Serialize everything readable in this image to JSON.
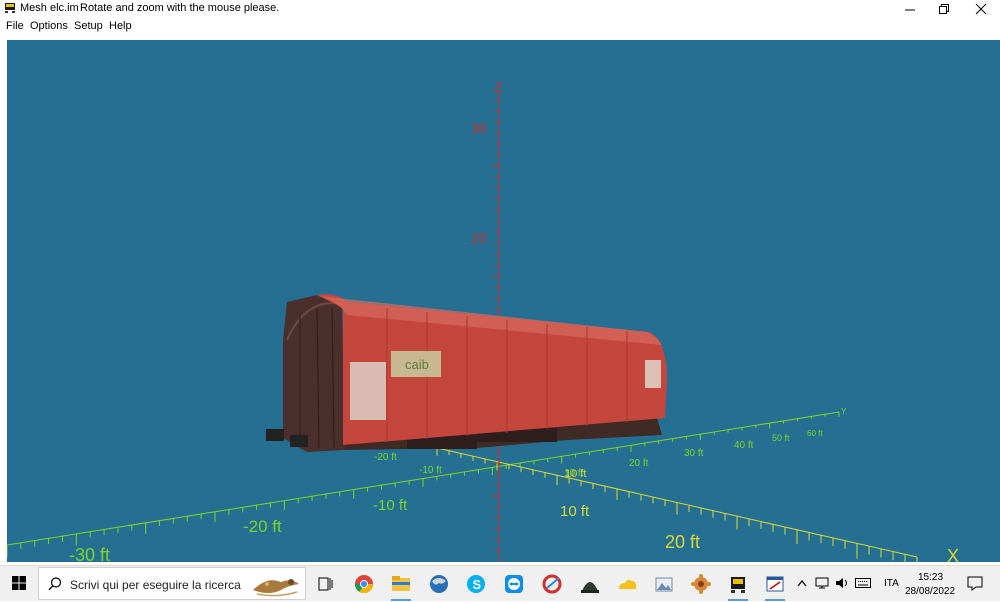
{
  "window": {
    "title": "Mesh elc.im",
    "hint": "Rotate and zoom with the mouse please."
  },
  "menu": [
    "File",
    "Options",
    "Setup",
    "Help"
  ],
  "viewport": {
    "background": "#256F93",
    "z_axis": {
      "label": "Z",
      "color": "#c4342e",
      "tick_labels": [
        "30",
        "20"
      ]
    },
    "y_axis": {
      "label": "Y",
      "color": "#7fd42a",
      "tick_labels": [
        "-20 ft",
        "-10 ft",
        "10 ft",
        "20 ft",
        "30 ft",
        "40 ft",
        "50 ft",
        "60 ft"
      ],
      "near_tick_labels": [
        "-30 ft",
        "-20 ft",
        "-10 ft"
      ]
    },
    "x_axis": {
      "label": "X",
      "color": "#d9d936",
      "tick_labels": [
        "10 ft",
        "10 ft",
        "20 ft"
      ]
    },
    "model": {
      "body_color": "#c4463c",
      "frame_color": "#4a2f2c",
      "logo_text": "caib"
    }
  },
  "taskbar": {
    "search_placeholder": "Scrivi qui per eseguire la ricerca",
    "apps": [
      "task-view",
      "chrome",
      "file-explorer",
      "browser-globe",
      "skype",
      "teamviewer",
      "ccleaner",
      "hat-app",
      "onedrive",
      "photo-viewer",
      "settings-app",
      "mesh-viewer",
      "editor-app"
    ],
    "language": "ITA",
    "time": "15:23",
    "date": "28/08/2022"
  }
}
